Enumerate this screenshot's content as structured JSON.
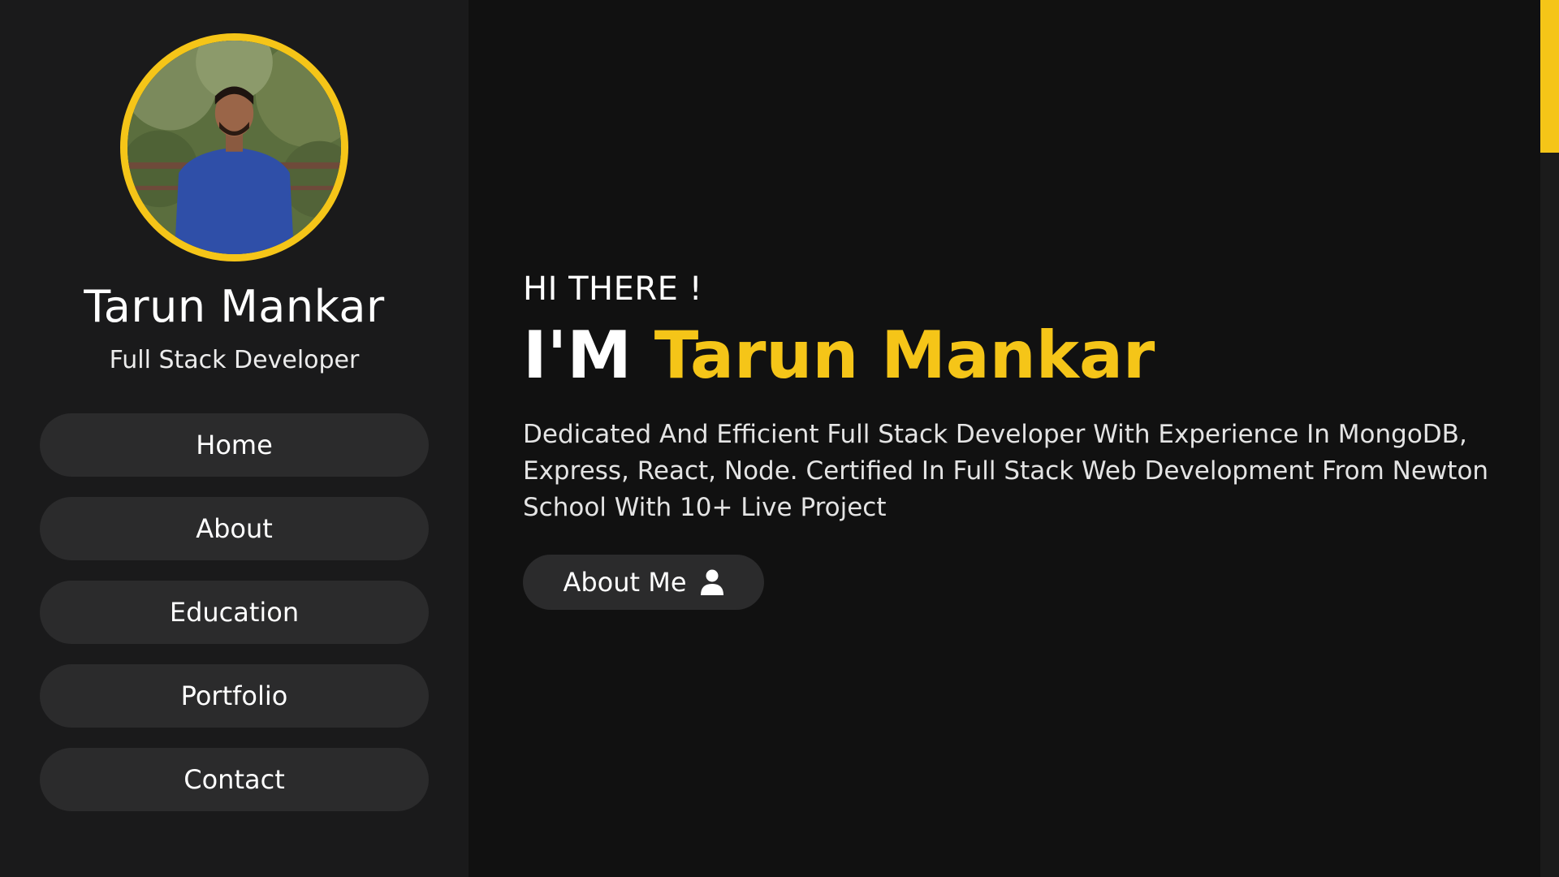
{
  "profile": {
    "name": "Tarun Mankar",
    "role": "Full Stack Developer"
  },
  "nav": {
    "items": [
      {
        "label": "Home"
      },
      {
        "label": "About"
      },
      {
        "label": "Education"
      },
      {
        "label": "Portfolio"
      },
      {
        "label": "Contact"
      }
    ]
  },
  "hero": {
    "greeting": "HI THERE !",
    "headline_prefix": "I'M",
    "headline_name": "Tarun Mankar",
    "intro": "Dedicated And Efficient Full Stack Developer With Experience In MongoDB, Express, React, Node. Certified In Full Stack Web Development From Newton School With 10+ Live Project",
    "cta_label": "About Me",
    "cta_icon": "user-icon"
  },
  "colors": {
    "accent": "#f5c518",
    "background": "#111111",
    "sidebar": "#1a1a1b",
    "button": "#2b2b2c"
  }
}
